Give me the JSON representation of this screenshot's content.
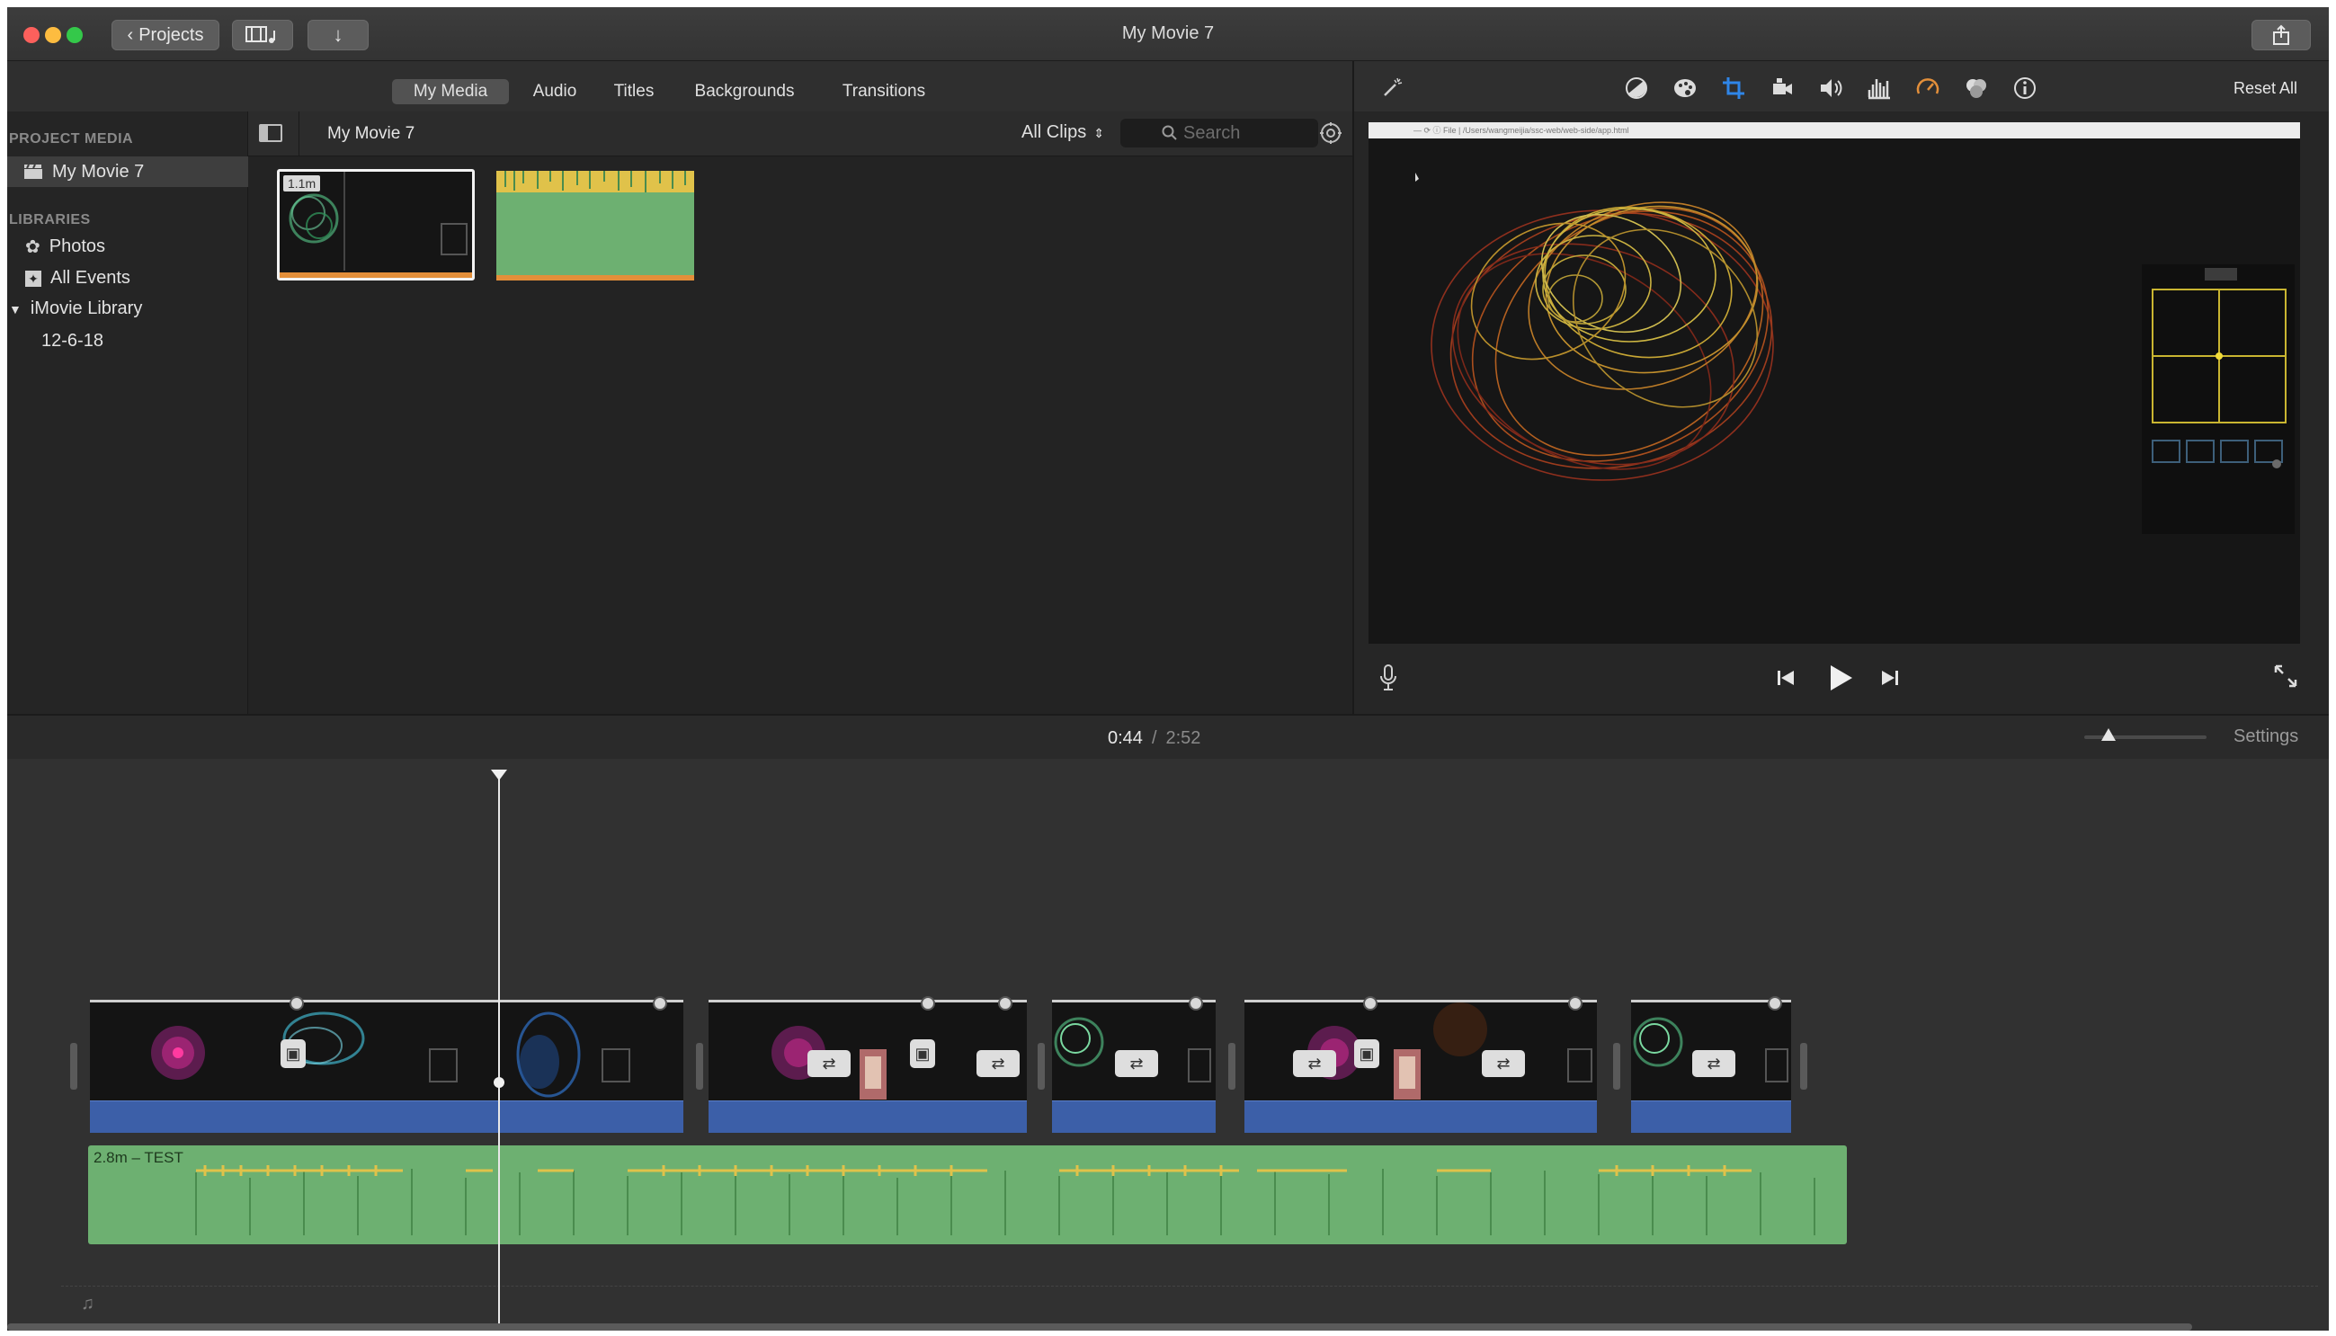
{
  "window": {
    "title": "My Movie 7",
    "back_label": "Projects"
  },
  "browser": {
    "tabs": [
      {
        "label": "My Media",
        "active": true
      },
      {
        "label": "Audio",
        "active": false
      },
      {
        "label": "Titles",
        "active": false
      },
      {
        "label": "Backgrounds",
        "active": false
      },
      {
        "label": "Transitions",
        "active": false
      }
    ],
    "sidebar": {
      "project_media_heading": "PROJECT MEDIA",
      "project_item": "My Movie 7",
      "libraries_heading": "LIBRARIES",
      "photos": "Photos",
      "all_events": "All Events",
      "library": "iMovie Library",
      "event": "12-6-18"
    },
    "clip_header": {
      "title": "My Movie 7",
      "filter": "All Clips",
      "search_placeholder": "Search"
    },
    "clips": [
      {
        "duration": "1.1m",
        "kind": "video"
      },
      {
        "kind": "audio"
      }
    ]
  },
  "viewer": {
    "reset_all": "Reset All",
    "tool_icons": [
      "color-balance-icon",
      "color-correction-icon",
      "crop-icon",
      "stabilization-icon",
      "volume-icon",
      "noise-reduction-icon",
      "speed-icon",
      "clip-filter-icon",
      "info-icon"
    ],
    "active_tool": "crop-icon"
  },
  "timeline": {
    "current_time": "0:44",
    "separator": "/",
    "total_time": "2:52",
    "settings": "Settings",
    "zoom_level": 0.2,
    "music_clip_label": "2.8m – TEST"
  },
  "colors": {
    "accent": "#2f86e8",
    "audio_green": "#6db071",
    "clip_audio_blue": "#3c5fa8",
    "waveform_yellow": "#e0c24a"
  }
}
